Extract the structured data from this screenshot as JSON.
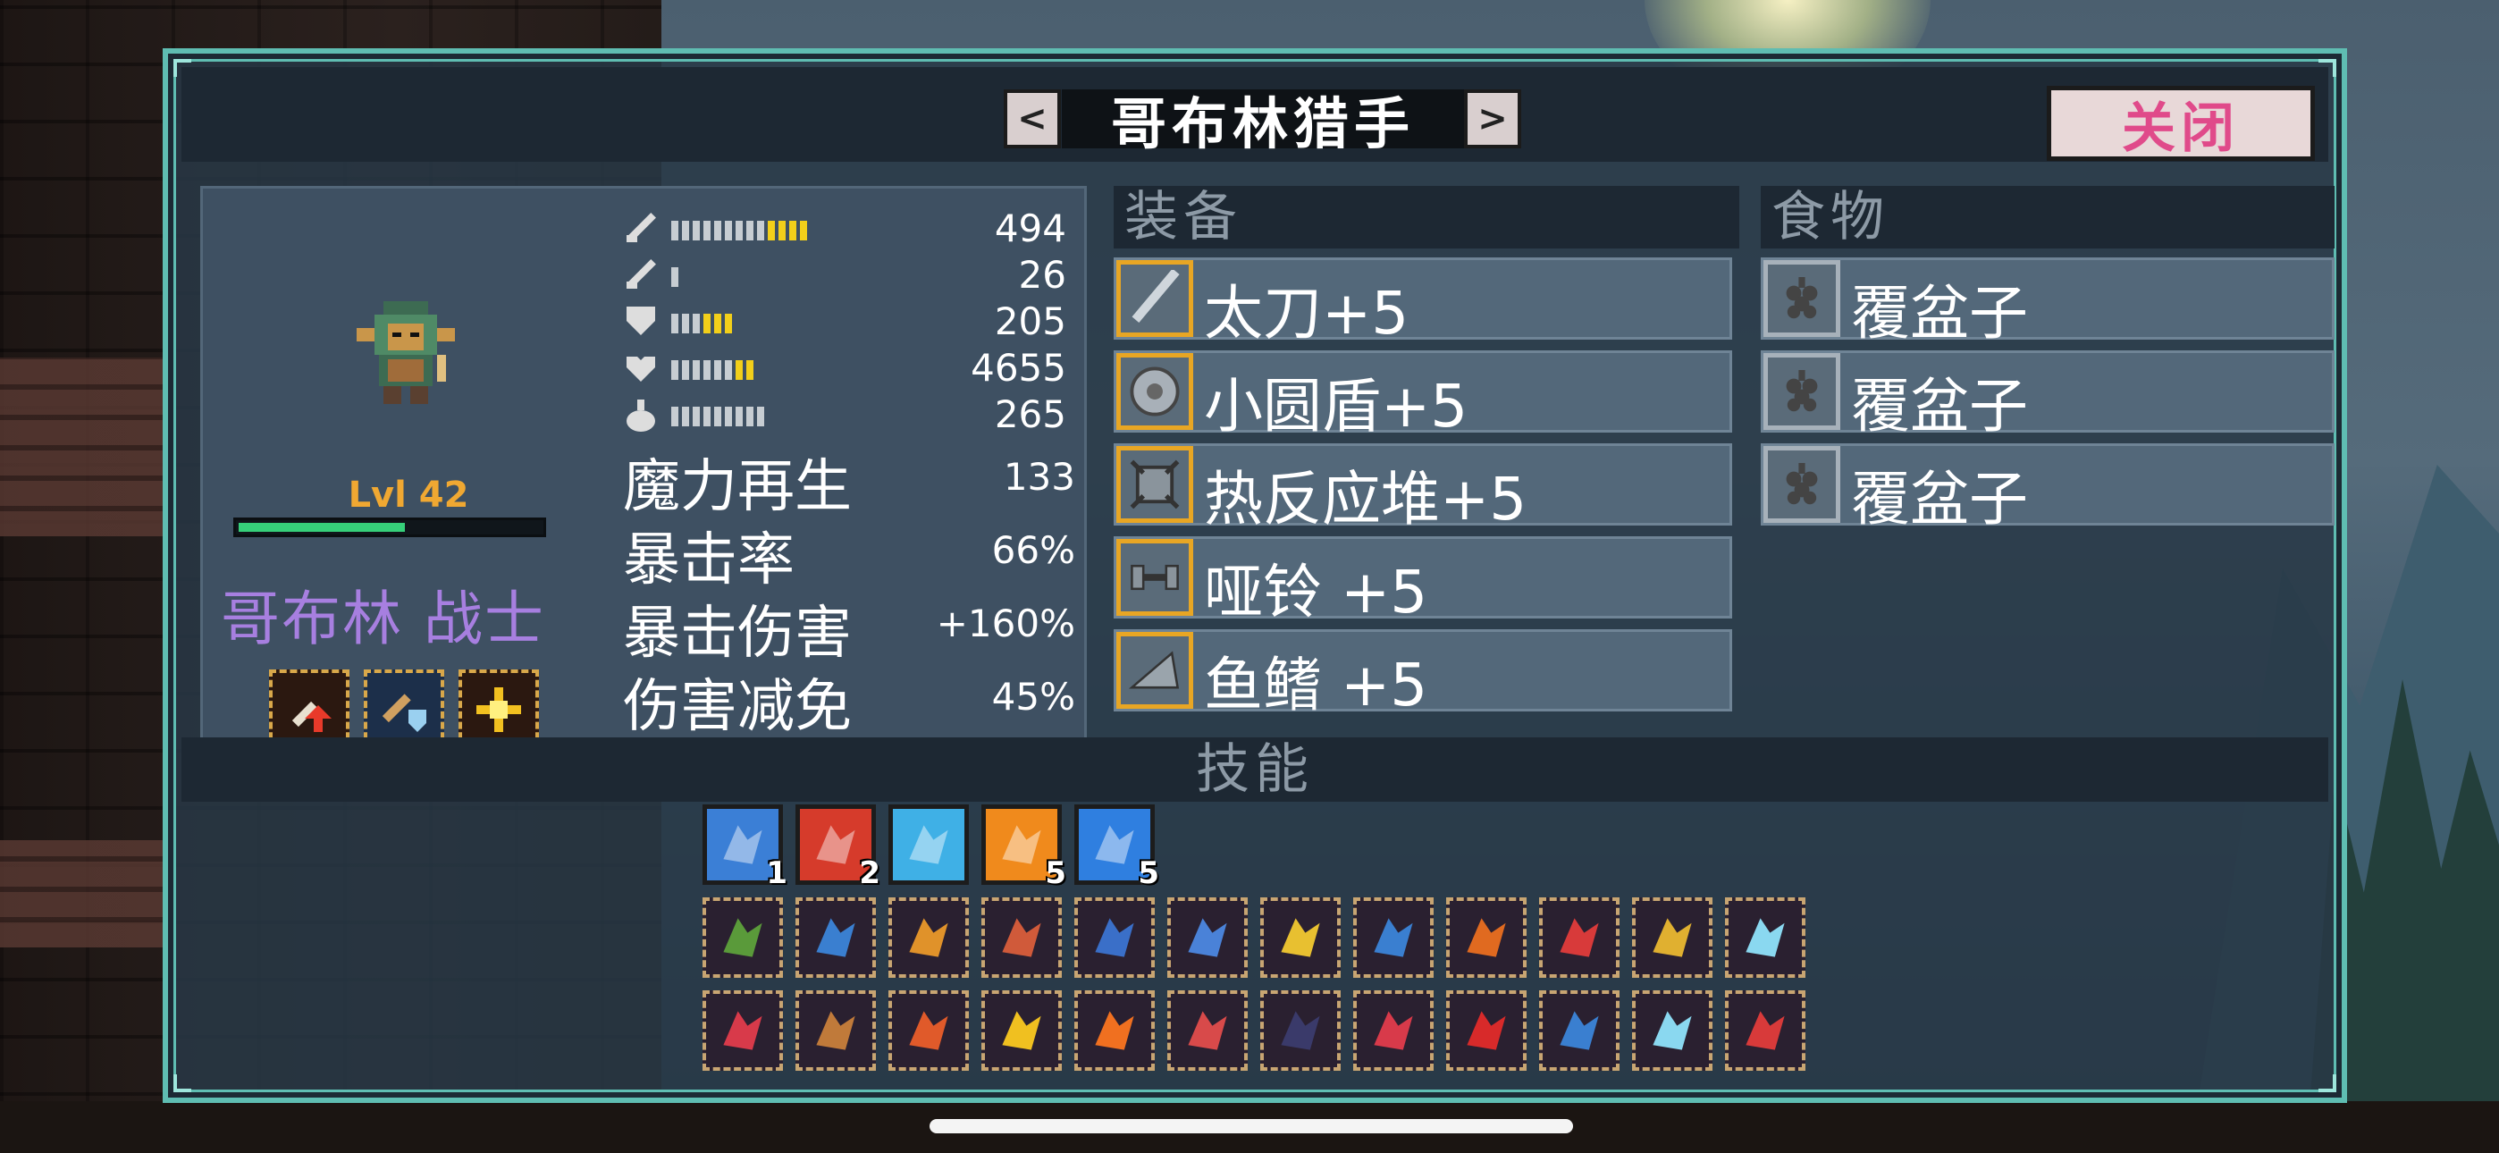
{
  "title": "哥布林猎手",
  "nav": {
    "prev": "<",
    "next": ">"
  },
  "close_label": "关闭",
  "character": {
    "level": "Lvl 42",
    "xp_fraction": 0.55,
    "class_name": "哥布林 战士"
  },
  "bar_stats": [
    {
      "icon": "sword-icon",
      "value": "494",
      "filled": 13,
      "yellow": 4
    },
    {
      "icon": "sword-icon",
      "value": "26",
      "filled": 1,
      "yellow": 0
    },
    {
      "icon": "shield-icon",
      "value": "205",
      "filled": 6,
      "yellow": 3
    },
    {
      "icon": "heart-icon",
      "value": "4655",
      "filled": 8,
      "yellow": 2
    },
    {
      "icon": "potion-icon",
      "value": "265",
      "filled": 9,
      "yellow": 0
    }
  ],
  "text_stats": [
    {
      "label": "魔力再生",
      "value": "133"
    },
    {
      "label": "暴击率",
      "value": "66%"
    },
    {
      "label": "暴击伤害",
      "value": "+160%"
    },
    {
      "label": "伤害减免",
      "value": "45%"
    }
  ],
  "equipment": {
    "header": "装备",
    "items": [
      {
        "icon": "katana-icon",
        "label": "太刀+5"
      },
      {
        "icon": "round-shield-icon",
        "label": "小圆盾+5"
      },
      {
        "icon": "reactor-icon",
        "label": "热反应堆+5"
      },
      {
        "icon": "dumbbell-icon",
        "label": "哑铃 +5"
      },
      {
        "icon": "fin-icon",
        "label": "鱼鳍 +5"
      }
    ]
  },
  "food": {
    "header": "食物",
    "items": [
      {
        "icon": "raspberry-icon",
        "label": "覆盆子"
      },
      {
        "icon": "raspberry-icon",
        "label": "覆盆子"
      },
      {
        "icon": "raspberry-icon",
        "label": "覆盆子"
      }
    ]
  },
  "skills": {
    "header": "技能",
    "active": [
      {
        "icon": "tornado-icon",
        "count": "1",
        "color": "#3b7fd6"
      },
      {
        "icon": "explosion-icon",
        "count": "2",
        "color": "#d63b2b"
      },
      {
        "icon": "ice-slash-icon",
        "count": "",
        "color": "#3fb0e6"
      },
      {
        "icon": "fire-slash-icon",
        "count": "5",
        "color": "#f08a1c"
      },
      {
        "icon": "wind-slash-icon",
        "count": "5",
        "color": "#2f7fe0"
      }
    ],
    "row1_colors": [
      "#5a9a3a",
      "#3a7fd0",
      "#e0922a",
      "#d05a3a",
      "#3a6fc8",
      "#4a82d8",
      "#e8c030",
      "#3a7fd0",
      "#e06a20",
      "#d83a3a",
      "#e0b030",
      "#8ad8f0"
    ],
    "row2_colors": [
      "#d83a4a",
      "#c07a3a",
      "#e05a2a",
      "#f0c020",
      "#f07020",
      "#d84a4a",
      "#3a3a6a",
      "#d83a4a",
      "#d82a2a",
      "#3a7fd0",
      "#8ad8f0",
      "#d83a3a"
    ]
  }
}
